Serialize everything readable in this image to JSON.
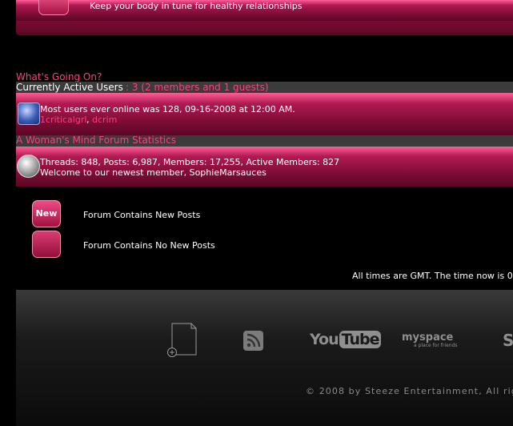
{
  "forum_banner": {
    "description": "Keep your body in tune for healthy relationships"
  },
  "whats_going_on": {
    "title": "What's Going On?",
    "active_users": {
      "label": "Currently Active Users",
      "count_text": ": 3 (2 members and 1 guests)"
    },
    "most_online": "Most users ever online was 128, 09-16-2008 at 12:00 AM.",
    "members": [
      "1criticalgrl",
      "dcrim"
    ],
    "member_separator": ","
  },
  "statistics": {
    "title": "A Woman's Mind Forum Statistics",
    "stats_text": "Threads: 848, Posts: 6,987, Members: 17,255, Active Members: 827",
    "welcome_prefix": "Welcome to our newest member, ",
    "newest_member": "SophieMarsauces"
  },
  "legend": {
    "new_icon_text": "New",
    "new_posts": "Forum Contains New Posts",
    "no_new_posts": "Forum Contains No New Posts"
  },
  "time_notice": "All times are GMT. The time now is 0",
  "footer": {
    "youtube_you": "You",
    "youtube_tube": "Tube",
    "myspace": "myspace",
    "myspace_sub": "a place for friends",
    "partial_logo": "S",
    "copyright": "© 2008 by Steeze Entertainment, All rig"
  },
  "colors": {
    "accent_pink": "#ff3d7f",
    "bar_pink": "#b01a50",
    "background": "#000000"
  }
}
